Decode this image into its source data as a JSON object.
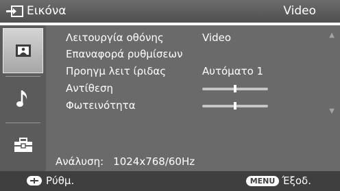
{
  "header": {
    "title": "Εικόνα",
    "mode": "Video",
    "icon": "input-icon"
  },
  "sidebar": {
    "items": [
      {
        "icon": "picture-icon",
        "active": true
      },
      {
        "icon": "music-note-icon",
        "active": false
      },
      {
        "icon": "toolbox-icon",
        "active": false
      }
    ]
  },
  "menu": {
    "items": [
      {
        "label": "Λειτουργία οθόνης",
        "value": "Video"
      },
      {
        "label": "Επαναφορά ρυθμίσεων",
        "value": ""
      },
      {
        "label": "Προηγμ λειτ ίριδας",
        "value": "Αυτόματο 1"
      },
      {
        "label": "Αντίθεση",
        "slider_fraction": 0.5
      },
      {
        "label": "Φωτεινότητα",
        "slider_fraction": 0.5
      }
    ],
    "scroll_up_icon": "up-arrow-icon",
    "scroll_down_icon": "down-arrow-icon"
  },
  "resolution": {
    "label": "Ανάλυση:",
    "value": "1024x768/60Hz"
  },
  "footer": {
    "adjust_label": "Ρύθμ.",
    "menu_key": "MENU",
    "exit_label": "Έξοδ."
  }
}
